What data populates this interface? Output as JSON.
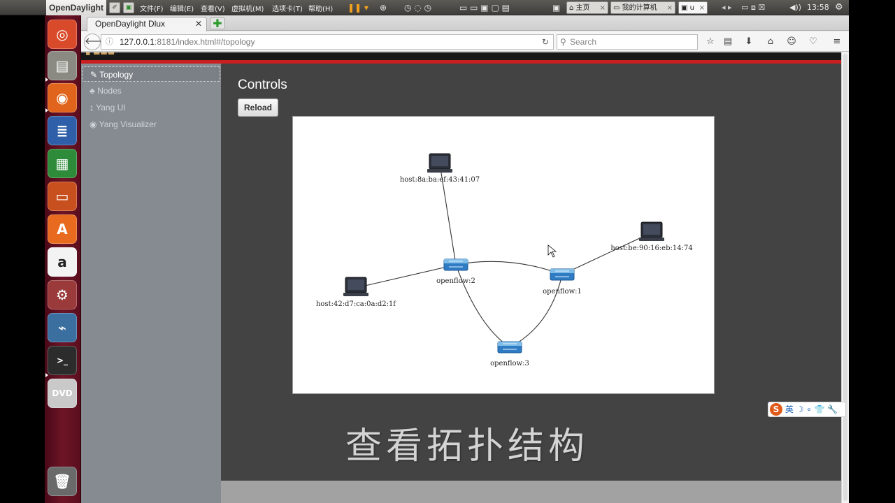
{
  "topbar": {
    "app_name": "OpenDaylight",
    "menus": [
      "文件(F)",
      "编辑(E)",
      "查看(V)",
      "虚拟机(M)",
      "选项卡(T)",
      "帮助(H)"
    ],
    "vm_tabs": [
      {
        "label": "主页",
        "icon": "home-icon"
      },
      {
        "label": "我的计算机",
        "icon": "computer-icon"
      },
      {
        "label": "u",
        "icon": "vm-icon"
      }
    ],
    "clock": "13:58"
  },
  "launcher": {
    "items": [
      {
        "name": "ubuntu-dash",
        "glyph": "◎",
        "color": "#d94a2a"
      },
      {
        "name": "files",
        "glyph": "▤",
        "color": "#8a8a82"
      },
      {
        "name": "firefox",
        "glyph": "◉",
        "color": "#e0641c"
      },
      {
        "name": "writer",
        "glyph": "≣",
        "color": "#2e5fa8"
      },
      {
        "name": "calc",
        "glyph": "▦",
        "color": "#2e8b3a"
      },
      {
        "name": "impress",
        "glyph": "▭",
        "color": "#c8501e"
      },
      {
        "name": "software-center",
        "glyph": "A",
        "color": "#e86a1e"
      },
      {
        "name": "amazon",
        "glyph": "a",
        "color": "#f3f3f3"
      },
      {
        "name": "system-settings",
        "glyph": "⚙",
        "color": "#9a3a3a"
      },
      {
        "name": "system-monitor",
        "glyph": "⌁",
        "color": "#3a6fa0"
      },
      {
        "name": "terminal",
        "glyph": ">_",
        "color": "#2c2c2c"
      },
      {
        "name": "dvd",
        "glyph": "DVD",
        "color": "#c9c9c9"
      }
    ],
    "trash": "trash"
  },
  "browser": {
    "tab_title": "OpenDaylight Dlux",
    "url_host": "127.0.0.1",
    "url_rest": ":8181/index.html#/topology",
    "search_placeholder": "Search"
  },
  "sidebar": {
    "items": [
      {
        "icon": "✎",
        "label": "Topology",
        "active": true
      },
      {
        "icon": "♣",
        "label": "Nodes",
        "active": false
      },
      {
        "icon": "↨",
        "label": "Yang UI",
        "active": false
      },
      {
        "icon": "◉",
        "label": "Yang Visualizer",
        "active": false
      }
    ]
  },
  "main": {
    "heading": "Controls",
    "reload_label": "Reload"
  },
  "topology": {
    "nodes": [
      {
        "id": "h1",
        "kind": "host",
        "label": "host:8a:ba:ef:43:41:07"
      },
      {
        "id": "h2",
        "kind": "host",
        "label": "host:be:90:16:eb:14:74"
      },
      {
        "id": "h3",
        "kind": "host",
        "label": "host:42:d7:ca:0a:d2:1f"
      },
      {
        "id": "s2",
        "kind": "switch",
        "label": "openflow:2"
      },
      {
        "id": "s1",
        "kind": "switch",
        "label": "openflow:1"
      },
      {
        "id": "s3",
        "kind": "switch",
        "label": "openflow:3"
      }
    ],
    "links": [
      {
        "from": "h1",
        "to": "s2"
      },
      {
        "from": "h3",
        "to": "s2"
      },
      {
        "from": "s2",
        "to": "s1"
      },
      {
        "from": "h2",
        "to": "s1"
      },
      {
        "from": "s2",
        "to": "s3"
      },
      {
        "from": "s1",
        "to": "s3"
      }
    ]
  },
  "caption": "查看拓扑结构",
  "ime": {
    "label": "英"
  }
}
